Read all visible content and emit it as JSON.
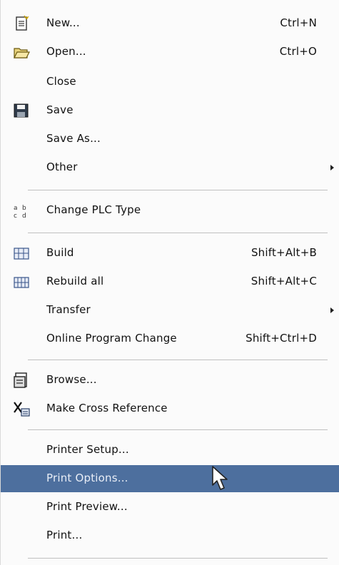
{
  "menu": {
    "items": [
      {
        "label": "New...",
        "shortcut": "Ctrl+N",
        "icon": "new-document-icon"
      },
      {
        "label": "Open...",
        "shortcut": "Ctrl+O",
        "icon": "open-folder-icon"
      },
      {
        "label": "Close",
        "shortcut": ""
      },
      {
        "label": "Save",
        "shortcut": "",
        "icon": "save-disk-icon"
      },
      {
        "label": "Save As...",
        "shortcut": ""
      },
      {
        "label": "Other",
        "shortcut": "",
        "submenu": true
      },
      {
        "label": "Change PLC Type",
        "shortcut": "",
        "icon": "change-plc-type-icon"
      },
      {
        "label": "Build",
        "shortcut": "Shift+Alt+B",
        "icon": "build-icon"
      },
      {
        "label": "Rebuild all",
        "shortcut": "Shift+Alt+C",
        "icon": "rebuild-all-icon"
      },
      {
        "label": "Transfer",
        "shortcut": "",
        "submenu": true
      },
      {
        "label": "Online Program Change",
        "shortcut": "Shift+Ctrl+D"
      },
      {
        "label": "Browse...",
        "shortcut": "",
        "icon": "browse-icon"
      },
      {
        "label": "Make Cross Reference",
        "shortcut": "",
        "icon": "cross-reference-icon"
      },
      {
        "label": "Printer Setup...",
        "shortcut": ""
      },
      {
        "label": "Print Options...",
        "shortcut": "",
        "highlighted": true
      },
      {
        "label": "Print Preview...",
        "shortcut": ""
      },
      {
        "label": "Print...",
        "shortcut": ""
      }
    ]
  },
  "colors": {
    "highlight": "#4d6f9e",
    "highlight_text": "#e9eef7",
    "menu_background": "#fbfbfb"
  }
}
